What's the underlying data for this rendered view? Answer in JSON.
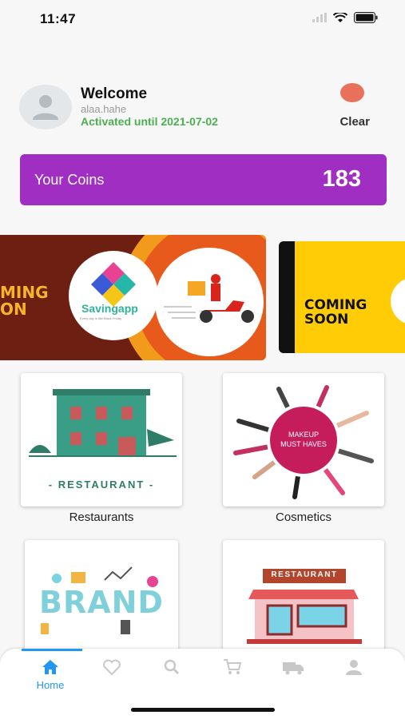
{
  "status": {
    "time": "11:47"
  },
  "profile": {
    "welcome": "Welcome",
    "username": "alaa.hahe",
    "activated": "Activated until 2021-07-02",
    "clear_label": "Clear"
  },
  "coins": {
    "label": "Your Coins",
    "value": "183"
  },
  "banners": [
    {
      "coming_text_line1": "MING",
      "coming_text_line2": "ON",
      "logo_name": "Savingapp",
      "logo_tagline": "Every day is like Black Friday"
    },
    {
      "coming_text_line1": "COMING",
      "coming_text_line2": "SOON"
    }
  ],
  "categories": [
    {
      "label": "Restaurants",
      "image_text": "- RESTAURANT -"
    },
    {
      "label": "Cosmetics",
      "image_text_line1": "MAKEUP",
      "image_text_line2": "MUST HAVES"
    },
    {
      "label": "",
      "image_text": "BRAND"
    },
    {
      "label": "",
      "image_text": "RESTAURANT"
    }
  ],
  "tabs": [
    {
      "label": "Home",
      "icon": "home-icon",
      "active": true
    },
    {
      "label": "",
      "icon": "heart-icon"
    },
    {
      "label": "",
      "icon": "search-icon"
    },
    {
      "label": "",
      "icon": "cart-icon"
    },
    {
      "label": "",
      "icon": "truck-icon"
    },
    {
      "label": "",
      "icon": "person-icon"
    }
  ],
  "colors": {
    "accent": "#a02ec3",
    "active_green": "#4caf50",
    "tab_blue": "#2196f3",
    "clear_dot": "#e8715b"
  }
}
